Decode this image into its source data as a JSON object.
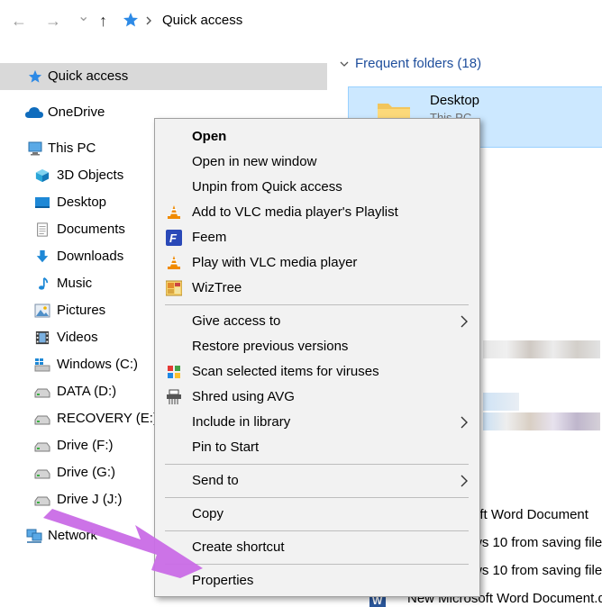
{
  "address_bar": {
    "back_glyph": "←",
    "forward_glyph": "→",
    "dropdown_glyph": "⌄",
    "up_glyph": "↑",
    "path": "Quick access"
  },
  "nav": {
    "quick_access": "Quick access",
    "onedrive": "OneDrive",
    "this_pc": "This PC",
    "objects3d": "3D Objects",
    "desktop": "Desktop",
    "documents": "Documents",
    "downloads": "Downloads",
    "music": "Music",
    "pictures": "Pictures",
    "videos": "Videos",
    "windows_c": "Windows (C:)",
    "data_d": "DATA (D:)",
    "recovery_e": "RECOVERY (E:)",
    "drive_f": "Drive (F:)",
    "drive_g": "Drive (G:)",
    "drive_j": "Drive J (J:)",
    "network": "Network"
  },
  "content": {
    "frequent_header": "Frequent folders (18)",
    "tile_name": "Desktop",
    "tile_sub": "This PC",
    "recent1": "oft Word Document",
    "recent2": "ws 10 from saving file",
    "recent3": "ws 10 from saving file",
    "recent4": "New Microsoft Word Document.d"
  },
  "menu": {
    "open": "Open",
    "open_new_window": "Open in new window",
    "unpin": "Unpin from Quick access",
    "vlc_playlist": "Add to VLC media player's Playlist",
    "feem": "Feem",
    "vlc_play": "Play with VLC media player",
    "wiztree": "WizTree",
    "give_access": "Give access to",
    "restore": "Restore previous versions",
    "scan": "Scan selected items for viruses",
    "shred": "Shred using AVG",
    "include_library": "Include in library",
    "pin_start": "Pin to Start",
    "send_to": "Send to",
    "copy": "Copy",
    "create_shortcut": "Create shortcut",
    "properties": "Properties"
  },
  "colors": {
    "selection": "#d9d9d9",
    "tile_bg": "#cce8ff",
    "header_blue": "#1e4e9c",
    "arrow": "#c96ce6"
  }
}
